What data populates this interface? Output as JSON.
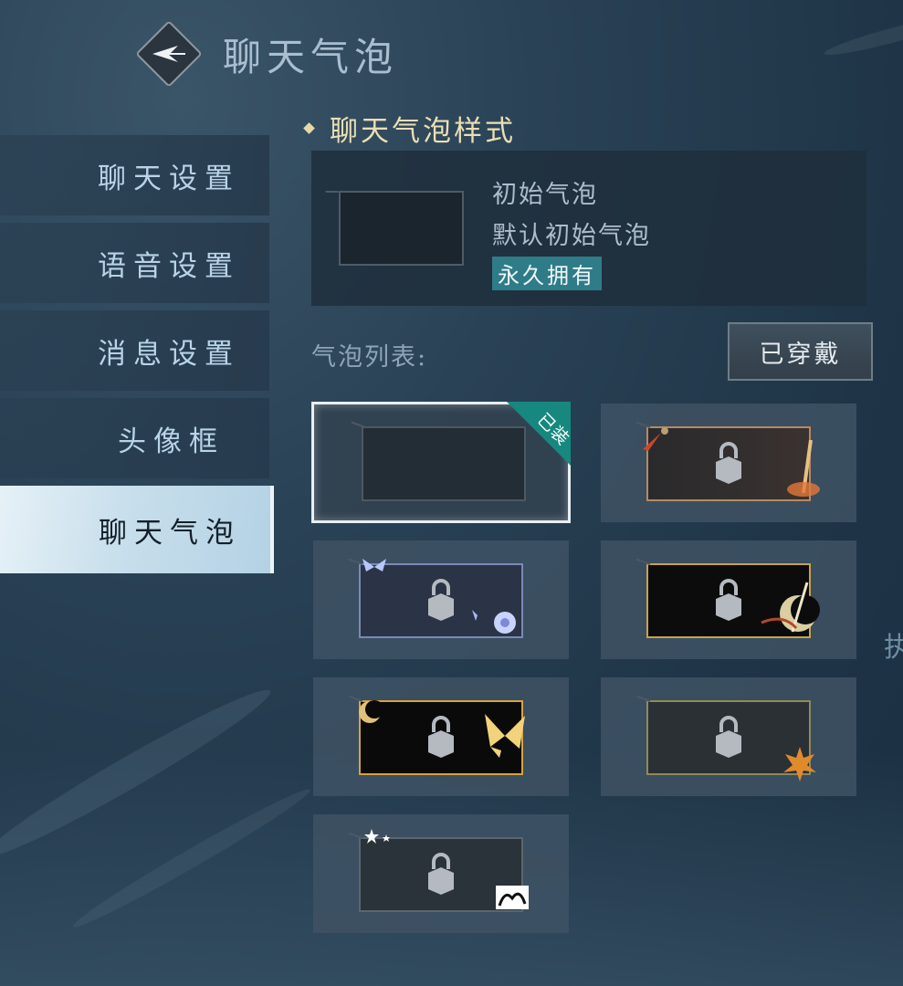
{
  "header": {
    "title": "聊天气泡"
  },
  "sidebar": {
    "items": [
      {
        "label": "聊天设置"
      },
      {
        "label": "语音设置"
      },
      {
        "label": "消息设置"
      },
      {
        "label": "头像框"
      },
      {
        "label": "聊天气泡"
      }
    ]
  },
  "section": {
    "title": "聊天气泡样式"
  },
  "preview": {
    "name": "初始气泡",
    "description": "默认初始气泡",
    "status": "永久拥有"
  },
  "list": {
    "label": "气泡列表:",
    "equipped_button": "已穿戴",
    "equipped_tag": "已装"
  },
  "edge_char": "执",
  "colors": {
    "accent_gold": "#eadfb3",
    "badge_teal": "#2f7c89",
    "equipped_tag": "#16887f",
    "active_tab": "#c8dfec"
  }
}
